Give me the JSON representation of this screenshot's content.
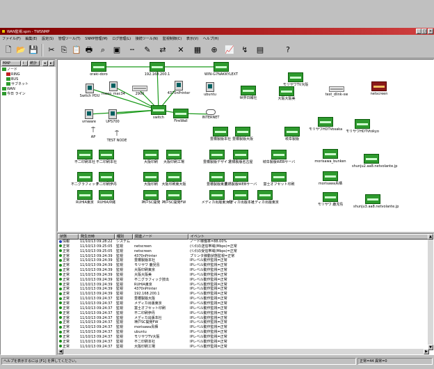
{
  "window": {
    "title": "WAN監視.spm - TWSNMP",
    "buttons": [
      "_",
      "□",
      "×"
    ]
  },
  "menu": [
    "ファイル(F)",
    "編集(E)",
    "設定(S)",
    "管理ツール(T)",
    "SNMP管理(M)",
    "ログ管理(L)",
    "接続ツール(N)",
    "監視制御(C)",
    "表示(V)",
    "ヘルプ(H)"
  ],
  "toolbar": {
    "icons": [
      "new-file-icon",
      "open-folder-icon",
      "save-icon",
      "cut-icon",
      "copy-icon",
      "paste-icon",
      "print-icon",
      "find-icon",
      "add-node-icon",
      "add-line-icon",
      "draw-icon",
      "move-icon",
      "delete-icon",
      "grid-icon",
      "zoom-icon",
      "chart-icon",
      "poll-icon",
      "mib-icon",
      "help-icon"
    ],
    "glyphs": [
      "🗋",
      "📂",
      "💾",
      "✂",
      "⎘",
      "📋",
      "🖶",
      "⌕",
      "▣",
      "╌",
      "✎",
      "⇄",
      "✕",
      "▦",
      "⊕",
      "📈",
      "↯",
      "▤",
      "?"
    ]
  },
  "tree": {
    "tabs": [
      "MAP",
      "i",
      "統計",
      "◂",
      "▸"
    ],
    "items": [
      {
        "label": "ノード",
        "indent": 0,
        "color": "#2e9a2e"
      },
      {
        "label": "RING",
        "indent": 1,
        "color": "#c02020"
      },
      {
        "label": "BUS",
        "indent": 1,
        "color": "#2e9a2e"
      },
      {
        "label": "サブネット",
        "indent": 1,
        "color": "#2e9a2e"
      },
      {
        "label": "WAN",
        "indent": 0,
        "color": "#2e9a2e"
      },
      {
        "label": "今日 ライン",
        "indent": 0,
        "color": "#2e9a2e"
      }
    ]
  },
  "map": {
    "nodes": [
      {
        "label": "oraki-doro",
        "type": "switch",
        "id": "n1"
      },
      {
        "label": "192.168.200.1",
        "type": "switch",
        "id": "n2"
      },
      {
        "label": "WIN-G7NAKKYLEXT",
        "type": "switch",
        "id": "n3"
      },
      {
        "label": "モリサワTV大阪",
        "type": "switch",
        "id": "n4"
      },
      {
        "label": "Switch PDU",
        "type": "pc",
        "id": "n5"
      },
      {
        "label": "meeo_mac34",
        "type": "pc",
        "id": "n6"
      },
      {
        "label": "2900",
        "type": "gray",
        "id": "n7"
      },
      {
        "label": "4370nPrinter",
        "type": "pc",
        "id": "n8"
      },
      {
        "label": "ubuntu",
        "type": "pc",
        "id": "n9"
      },
      {
        "label": "世界日報社",
        "type": "switch",
        "id": "n10"
      },
      {
        "label": "大阪大阪美",
        "type": "switch",
        "id": "n11"
      },
      {
        "label": "test_dlink-sw",
        "type": "gray",
        "id": "n12"
      },
      {
        "label": "netscreen",
        "type": "red",
        "id": "n13"
      },
      {
        "label": "vmware",
        "type": "pc",
        "id": "n14"
      },
      {
        "label": "UPS700",
        "type": "pc",
        "id": "n15"
      },
      {
        "label": "switch",
        "type": "switch",
        "id": "n16"
      },
      {
        "label": "FireWall",
        "type": "switch",
        "id": "n17"
      },
      {
        "label": "INTERNET",
        "type": "cloud",
        "id": "n18"
      },
      {
        "label": "モリサワHDTVosaka",
        "type": "switch",
        "id": "n19"
      },
      {
        "label": "モリサワHDTVtokyo",
        "type": "switch",
        "id": "n20"
      },
      {
        "label": "AP",
        "type": "ant",
        "id": "n21"
      },
      {
        "label": "TEST NODE",
        "type": "ant",
        "id": "n22"
      },
      {
        "label": "豊橋製版本社",
        "type": "switch",
        "id": "n23"
      },
      {
        "label": "豊橋製版大阪",
        "type": "switch",
        "id": "n24"
      },
      {
        "label": "岐阜製版",
        "type": "switch",
        "id": "n25"
      },
      {
        "label": "不二印刷本社",
        "type": "switch",
        "id": "n26"
      },
      {
        "label": "不二印刷本社",
        "type": "switch",
        "id": "n27"
      },
      {
        "label": "大阪印刷",
        "type": "switch",
        "id": "n28"
      },
      {
        "label": "大阪印刷工場",
        "type": "switch",
        "id": "n29"
      },
      {
        "label": "豊橋製版デザイン",
        "type": "switch",
        "id": "n30"
      },
      {
        "label": "豊橋製版名古屋",
        "type": "switch",
        "id": "n31"
      },
      {
        "label": "岐阜製版WEBサーバ",
        "type": "switch",
        "id": "n32"
      },
      {
        "label": "morisawa_bunken",
        "type": "switch",
        "id": "n33"
      },
      {
        "label": "shunju2.aa8.netvolante.jp",
        "type": "switch",
        "id": "n34"
      },
      {
        "label": "不二グラフィック",
        "type": "switch",
        "id": "n35"
      },
      {
        "label": "不二印刷伊丹",
        "type": "switch",
        "id": "n36"
      },
      {
        "label": "大阪印刷",
        "type": "switch",
        "id": "n37"
      },
      {
        "label": "大阪印刷東大阪",
        "type": "switch",
        "id": "n38"
      },
      {
        "label": "豊橋製版東京",
        "type": "switch",
        "id": "n39"
      },
      {
        "label": "豊橋製版WEBサーバ",
        "type": "switch",
        "id": "n40"
      },
      {
        "label": "富士オフセット印刷",
        "type": "switch",
        "id": "n41"
      },
      {
        "label": "morisawa鳥栖",
        "type": "switch",
        "id": "n42"
      },
      {
        "label": "RUHIA東京",
        "type": "switch",
        "id": "n43"
      },
      {
        "label": "RUHIA沖縄",
        "type": "switch",
        "id": "n44"
      },
      {
        "label": "神戸SC開発",
        "type": "switch",
        "id": "n45"
      },
      {
        "label": "神戸SC開発FW",
        "type": "switch",
        "id": "n46"
      },
      {
        "label": "メディカ出版東大阪",
        "type": "switch",
        "id": "n47"
      },
      {
        "label": "メディカ出版本社",
        "type": "switch",
        "id": "n48"
      },
      {
        "label": "メディカ出版東京",
        "type": "switch",
        "id": "n49"
      },
      {
        "label": "モリサワ 鹿児島",
        "type": "switch",
        "id": "n50"
      },
      {
        "label": "shunju3.aa8.netvolante.jp",
        "type": "switch",
        "id": "n51"
      }
    ]
  },
  "log": {
    "columns": [
      "状態",
      "発生日時",
      "種別",
      "関連ノード",
      "イベント"
    ],
    "rows": [
      {
        "status": "情報",
        "time": "11/10/13 09:28:22",
        "type": "システム",
        "node": "",
        "event": "ノード稼働率=88.00%",
        "info": true
      },
      {
        "status": "正常",
        "time": "11/10/13 09:25:05",
        "type": "監視",
        "node": "netscreen",
        "event": "(ｲﾝﾀ)の送信帯域(Mbps)=正常"
      },
      {
        "status": "正常",
        "time": "11/10/13 09:25:05",
        "type": "監視",
        "node": "netscreen",
        "event": "(ｲﾝﾀ)の受信帯域(Mbps)=正常"
      },
      {
        "status": "正常",
        "time": "11/10/13 09:24:39",
        "type": "監視",
        "node": "4370nPrinter",
        "event": "プリンタ稼動状態監視=正常"
      },
      {
        "status": "正常",
        "time": "11/10/13 09:24:39",
        "type": "監視",
        "node": "豊橋製版本社",
        "event": "IPレベル動作監視=正常"
      },
      {
        "status": "正常",
        "time": "11/10/13 09:24:39",
        "type": "監視",
        "node": "モリサワ 鹿児島",
        "event": "IPレベル動作監視=正常"
      },
      {
        "status": "正常",
        "time": "11/10/13 09:24:39",
        "type": "監視",
        "node": "大阪印刷東京",
        "event": "IPレベル動作監視=正常"
      },
      {
        "status": "正常",
        "time": "11/10/13 09:24:39",
        "type": "監視",
        "node": "大阪大阪美",
        "event": "IPレベル動作監視=正常"
      },
      {
        "status": "正常",
        "time": "11/10/13 09:24:39",
        "type": "監視",
        "node": "不二グラフィック技出",
        "event": "IPレベル動作監視=正常"
      },
      {
        "status": "正常",
        "time": "11/10/13 09:24:39",
        "type": "監視",
        "node": "RUHIA東京",
        "event": "IPレベル動作監視=正常"
      },
      {
        "status": "正常",
        "time": "11/10/13 09:24:39",
        "type": "監視",
        "node": "4370nPrinter",
        "event": "IPレベル動作監視=正常"
      },
      {
        "status": "正常",
        "time": "11/10/13 09:24:39",
        "type": "監視",
        "node": "192.168.200.1",
        "event": "IPレベル動作監視=正常"
      },
      {
        "status": "正常",
        "time": "11/10/13 09:24:37",
        "type": "監視",
        "node": "豊橋製版大阪",
        "event": "IPレベル動作監視=正常"
      },
      {
        "status": "正常",
        "time": "11/10/13 09:24:37",
        "type": "監視",
        "node": "メディカ出版東京",
        "event": "IPレベル動作監視=正常"
      },
      {
        "status": "正常",
        "time": "11/10/13 09:24:37",
        "type": "監視",
        "node": "富士オフセット印刷",
        "event": "IPレベル動作監視=正常"
      },
      {
        "status": "正常",
        "time": "11/10/13 09:24:37",
        "type": "監視",
        "node": "不二印刷伊丹",
        "event": "IPレベル動作監視=正常"
      },
      {
        "status": "正常",
        "time": "11/10/13 09:24:37",
        "type": "監視",
        "node": "メディカ出版本社",
        "event": "IPレベル動作監視=正常"
      },
      {
        "status": "正常",
        "time": "11/10/13 09:24:37",
        "type": "監視",
        "node": "神戸SC開発FW",
        "event": "IPレベル動作監視=正常"
      },
      {
        "status": "正常",
        "time": "11/10/13 09:24:37",
        "type": "監視",
        "node": "morisawa鳥栖",
        "event": "IPレベル動作監視=正常"
      },
      {
        "status": "正常",
        "time": "11/10/13 09:24:37",
        "type": "監視",
        "node": "ubuntu",
        "event": "IPレベル動作監視=正常"
      },
      {
        "status": "正常",
        "time": "11/10/13 09:24:37",
        "type": "監視",
        "node": "モリサワTV大阪",
        "event": "IPレベル動作監視=正常"
      },
      {
        "status": "正常",
        "time": "11/10/13 09:24:37",
        "type": "監視",
        "node": "不二印刷本社",
        "event": "IPレベル動作監視=正常"
      },
      {
        "status": "正常",
        "time": "11/10/13 09:24:37",
        "type": "監視",
        "node": "大阪印刷工場",
        "event": "IPレベル動作監視=正常"
      }
    ]
  },
  "status": {
    "help": "ヘルプを表示するには [F1] を押してください。",
    "counts": "正常=44 異常=0"
  }
}
